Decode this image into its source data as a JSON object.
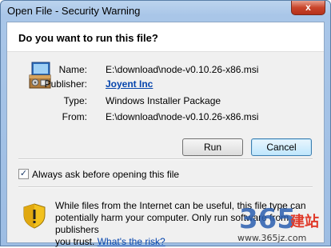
{
  "window": {
    "title": "Open File - Security Warning",
    "close_glyph": "x"
  },
  "dialog": {
    "question": "Do you want to run this file?",
    "fields": {
      "name_label": "Name:",
      "name_value": "E:\\download\\node-v0.10.26-x86.msi",
      "publisher_label": "Publisher:",
      "publisher_value": "Joyent Inc",
      "type_label": "Type:",
      "type_value": "Windows Installer Package",
      "from_label": "From:",
      "from_value": "E:\\download\\node-v0.10.26-x86.msi"
    },
    "run_label": "Run",
    "cancel_label": "Cancel",
    "always_ask_label": "Always ask before opening this file",
    "always_ask_checked": true,
    "warning_line1": "While files from the Internet can be useful, this file type can",
    "warning_line2": "potentially harm your computer. Only run software from publishers",
    "warning_line3_prefix": "you trust.",
    "warning_link": "What's the risk?"
  },
  "watermark": {
    "url": "www.365jz.com",
    "logo_text": "365",
    "logo_suffix": "建站"
  },
  "colors": {
    "accent_link": "#0645ad",
    "close_button": "#c9452b",
    "warning_yellow": "#f2c11e"
  },
  "icons": [
    "installer-package-icon",
    "shield-warning-icon",
    "close-icon",
    "checkmark-icon"
  ]
}
